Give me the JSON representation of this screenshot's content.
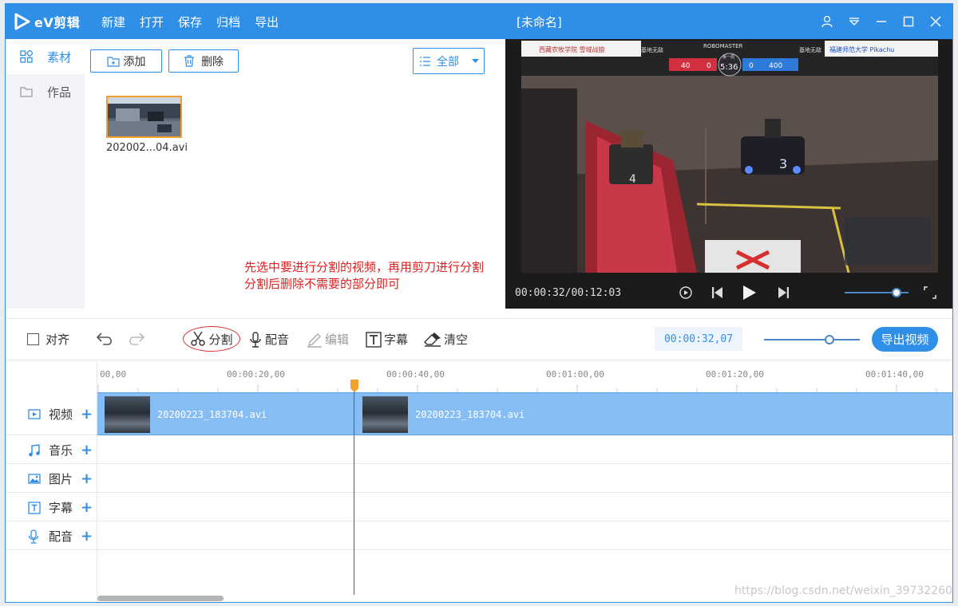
{
  "app": {
    "logo_text": "eV剪辑",
    "doc_title": "[未命名]"
  },
  "menu": [
    "新建",
    "打开",
    "保存",
    "归档",
    "导出"
  ],
  "sidebar": {
    "items": [
      {
        "label": "素材",
        "icon": "grid-icon",
        "active": true
      },
      {
        "label": "作品",
        "icon": "folder-icon",
        "active": false
      }
    ]
  },
  "media": {
    "add_label": "添加",
    "delete_label": "删除",
    "filter_label": "全部",
    "file_name": "202002...04.avi",
    "annotation_line1": "先选中要进行分割的视频，再用剪刀进行分割",
    "annotation_line2": "分割后删除不需要的部分即可"
  },
  "preview": {
    "time": "00:00:32/00:12:03",
    "overlay": {
      "brand": "ROBOMASTER",
      "team_left": "西藏农牧学院 雪域战狼",
      "team_right": "福建师范大学 Pikachu",
      "base_left": "基地无敌",
      "base_right": "基地无敌",
      "clock": "5:36",
      "round": "第一局",
      "score_left": "40",
      "score_mid_left": "0",
      "score_mid_right": "0",
      "score_right": "400",
      "robot_left": "4",
      "robot_right": "3"
    },
    "volume_level": 0.8
  },
  "toolbar": {
    "align_label": "对齐",
    "split_label": "分割",
    "dub_label": "配音",
    "edit_label": "编辑",
    "subtitle_label": "字幕",
    "clear_label": "清空",
    "current_time": "00:00:32,07",
    "export_label": "导出视频",
    "zoom_level": 0.7
  },
  "timeline": {
    "ticks": [
      "00,00",
      "00:00:20,00",
      "00:00:40,00",
      "00:01:00,00",
      "00:01:20,00",
      "00:01:40,00"
    ],
    "tracks": [
      {
        "label": "视频",
        "icon": "video-icon"
      },
      {
        "label": "音乐",
        "icon": "music-icon"
      },
      {
        "label": "图片",
        "icon": "image-icon"
      },
      {
        "label": "字幕",
        "icon": "text-icon"
      },
      {
        "label": "配音",
        "icon": "mic-icon"
      }
    ],
    "clips": [
      {
        "name": "20200223_183704.avi"
      },
      {
        "name": "20200223_183704.avi"
      }
    ]
  },
  "watermark": "https://blog.csdn.net/weixin_39732260",
  "colors": {
    "accent": "#2f8fe6",
    "clip_track": "#87bdf5",
    "annotation": "#e02020",
    "playhead": "#d23030"
  }
}
